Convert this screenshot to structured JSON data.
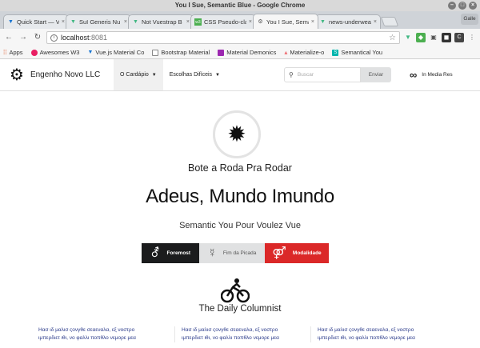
{
  "window": {
    "title": "You I Sue, Semantic Blue - Google Chrome"
  },
  "tabs": [
    {
      "label": "Quick Start — Vi",
      "icon": "vuetify-icon",
      "color": "#1976d2",
      "active": false
    },
    {
      "label": "SuI Generis Nu",
      "icon": "vue-icon",
      "color": "#41b883",
      "active": false
    },
    {
      "label": "Not Vuestrap B",
      "icon": "vue-icon",
      "color": "#41b883",
      "active": false
    },
    {
      "label": "CSS Pseudo-clas",
      "icon": "w3-icon",
      "color": "#4caf50",
      "active": false
    },
    {
      "label": "You I Sue, Sema",
      "icon": "gear-icon",
      "color": "#555555",
      "active": true
    },
    {
      "label": "news-underwea",
      "icon": "vue-icon",
      "color": "#41b883",
      "active": false
    }
  ],
  "profile_label": "Galle",
  "address": {
    "host": "localhost",
    "port": ":8081"
  },
  "bookmarks": [
    {
      "label": "Apps",
      "color": "#e05a2b"
    },
    {
      "label": "Awesomes W3",
      "color": "#e91e63"
    },
    {
      "label": "Vue.js Material Co",
      "color": "#1976d2"
    },
    {
      "label": "Bootstrap Material",
      "color": "#888888"
    },
    {
      "label": "Material Demonics",
      "color": "#9c27b0"
    },
    {
      "label": "Materialize-o",
      "color": "#ee6e73"
    },
    {
      "label": "Semantical You",
      "color": "#00b5ad"
    }
  ],
  "navbar": {
    "brand": "Engenho Novo LLC",
    "menu": [
      {
        "label": "O Cardápio",
        "active": true
      },
      {
        "label": "Escolhas Difíceis",
        "active": false
      }
    ],
    "search_placeholder": "Buscar",
    "search_button": "Enviar",
    "right_label": "In Media Res"
  },
  "hero": {
    "slogan": "Bote a Roda Pra Rodar",
    "heading": "Adeus, Mundo Imundo",
    "subheading": "Semantic You Pour Voulez Vue",
    "buttons": [
      {
        "label": "Foremost",
        "symbol": "⚦",
        "style": "dark"
      },
      {
        "label": "Fim da Picada",
        "symbol": "☿",
        "style": "grey"
      },
      {
        "label": "Modalidade",
        "symbol": "⚤",
        "style": "red"
      }
    ]
  },
  "column": {
    "title": "The Daily Columnist",
    "columns": [
      {
        "line1": "Ηασ ιδ μαλισ ςονγθε σεαεναλα, εξ νοστρο",
        "line2": "ιμπερδιετ ιθι, νο φαλλι ποπθλο νεμορε μεα"
      },
      {
        "line1": "Ηασ ιδ μαλισ ςονγθε σεαεναλα, εξ νοστρο",
        "line2": "ιμπερδιετ ιθι, νο φαλλι ποπθλο νεμορε μεα"
      },
      {
        "line1": "Ηασ ιδ μαλισ ςονγθε σεαεναλα, εξ νοστρο",
        "line2": "ιμπερδιετ ιθι, νο φαλλι ποπθλο νεμορε μεα"
      }
    ]
  }
}
